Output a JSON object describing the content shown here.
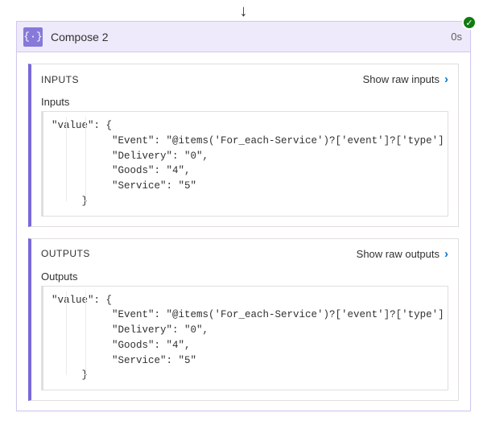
{
  "action": {
    "title": "Compose 2",
    "icon_glyph": "{·}",
    "duration": "0s",
    "status": "succeeded"
  },
  "sections": {
    "inputs": {
      "header_label": "INPUTS",
      "show_raw_label": "Show raw inputs",
      "field_label": "Inputs",
      "code": "\"value\": {\n          \"Event\": \"@items('For_each-Service')?['event']?['type']\n          \"Delivery\": \"0\",\n          \"Goods\": \"4\",\n          \"Service\": \"5\"\n     }"
    },
    "outputs": {
      "header_label": "OUTPUTS",
      "show_raw_label": "Show raw outputs",
      "field_label": "Outputs",
      "code": "\"value\": {\n          \"Event\": \"@items('For_each-Service')?['event']?['type']\n          \"Delivery\": \"0\",\n          \"Goods\": \"4\",\n          \"Service\": \"5\"\n     }"
    }
  }
}
